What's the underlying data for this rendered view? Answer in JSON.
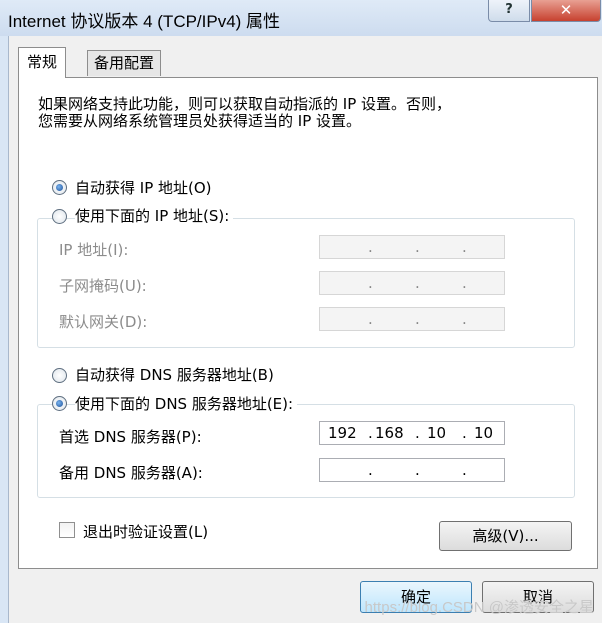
{
  "window": {
    "title": "Internet 协议版本 4 (TCP/IPv4) 属性",
    "help_label": "?",
    "close_label": "✕"
  },
  "tabs": [
    {
      "label": "常规",
      "active": true
    },
    {
      "label": "备用配置",
      "active": false
    }
  ],
  "description": {
    "line1": "如果网络支持此功能，则可以获取自动指派的 IP 设置。否则，",
    "line2": "您需要从网络系统管理员处获得适当的 IP 设置。"
  },
  "ip_mode": {
    "auto_label": "自动获得 IP 地址(O)",
    "manual_label": "使用下面的 IP 地址(S):",
    "selected": "auto"
  },
  "ip_fields": {
    "ip_label": "IP 地址(I):",
    "subnet_label": "子网掩码(U):",
    "gateway_label": "默认网关(D):"
  },
  "dns_mode": {
    "auto_label": "自动获得 DNS 服务器地址(B)",
    "manual_label": "使用下面的 DNS 服务器地址(E):",
    "selected": "manual"
  },
  "dns_fields": {
    "preferred_label": "首选 DNS 服务器(P):",
    "alternate_label": "备用 DNS 服务器(A):",
    "preferred_octets": [
      "192",
      "168",
      "10",
      "10"
    ],
    "alternate_octets": [
      "",
      "",
      "",
      ""
    ]
  },
  "validate": {
    "label": "退出时验证设置(L)",
    "checked": false
  },
  "buttons": {
    "advanced": "高级(V)...",
    "ok": "确定",
    "cancel": "取消"
  },
  "watermark": "https://blog.CSDN @渗透安全之星"
}
